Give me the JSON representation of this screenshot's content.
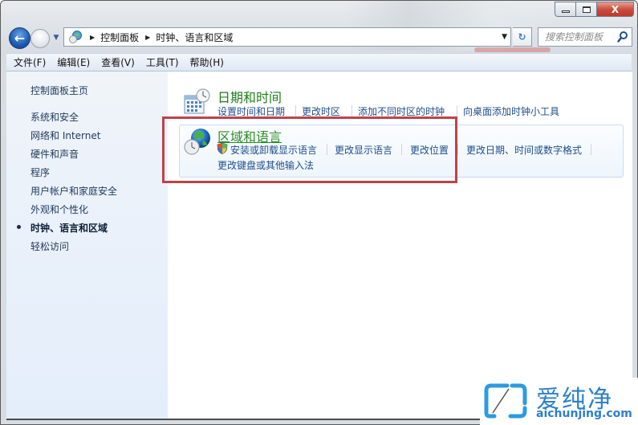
{
  "window": {
    "close_label": "X"
  },
  "navigation": {
    "breadcrumbs": [
      "控制面板",
      "时钟、语言和区域"
    ],
    "search_placeholder": "搜索控制面板"
  },
  "menubar": {
    "items": [
      "文件(F)",
      "编辑(E)",
      "查看(V)",
      "工具(T)",
      "帮助(H)"
    ]
  },
  "sidebar": {
    "home": "控制面板主页",
    "items": [
      {
        "label": "系统和安全",
        "active": false
      },
      {
        "label": "网络和 Internet",
        "active": false
      },
      {
        "label": "硬件和声音",
        "active": false
      },
      {
        "label": "程序",
        "active": false
      },
      {
        "label": "用户帐户和家庭安全",
        "active": false
      },
      {
        "label": "外观和个性化",
        "active": false
      },
      {
        "label": "时钟、语言和区域",
        "active": true
      },
      {
        "label": "轻松访问",
        "active": false
      }
    ]
  },
  "categories": [
    {
      "title": "日期和时间",
      "icon": "calendar-clock-icon",
      "links": [
        "设置时间和日期",
        "更改时区",
        "添加不同时区的时钟",
        "向桌面添加时钟小工具"
      ]
    },
    {
      "title": "区域和语言",
      "icon": "globe-clock-icon",
      "links": [
        "安装或卸载显示语言",
        "更改显示语言",
        "更改位置",
        "更改日期、时间或数字格式",
        "更改键盘或其他输入法"
      ]
    }
  ],
  "watermark": {
    "cn": "爱纯净",
    "en": "aichunjing.com"
  },
  "colors": {
    "category_title": "#1e7e1a",
    "link": "#1e4d8c",
    "highlight_outline": "#c0424b",
    "watermark": "#2c7fcc"
  }
}
